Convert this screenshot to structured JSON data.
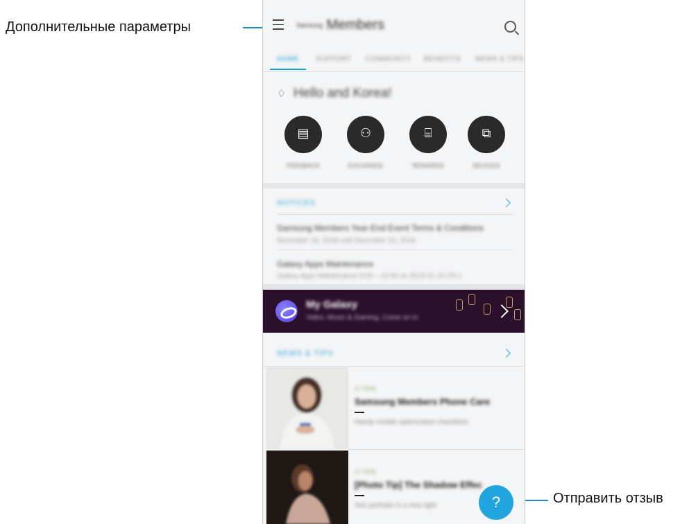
{
  "callouts": {
    "left": "Дополнительные параметры",
    "right": "Отправить отзыв"
  },
  "app": {
    "title_prefix": "Samsung",
    "title": "Members",
    "menu_icon": "hamburger-menu-icon",
    "search_icon": "search-icon"
  },
  "tabs": [
    "HOME",
    "SUPPORT",
    "COMMUNITY",
    "BENEFITS",
    "NEWS & TIPS"
  ],
  "greeting": "Hello and Korea!",
  "quick_actions": [
    {
      "icon": "document-icon",
      "glyph": "▤",
      "label": "FEEDBACK"
    },
    {
      "icon": "people-icon",
      "glyph": "⚇",
      "label": "EXCHANGE"
    },
    {
      "icon": "gift-icon",
      "glyph": "⌸",
      "label": "REWARDS"
    },
    {
      "icon": "devices-icon",
      "glyph": "⧉",
      "label": "DEVICES"
    }
  ],
  "notices": {
    "title": "NOTICES",
    "items": [
      {
        "title": "Samsung Members Year-End Event Terms & Conditions",
        "sub": "December 18, 2018 until December 31, 2018"
      },
      {
        "title": "Galaxy Apps Maintenance",
        "sub": "Galaxy Apps Maintenance 9:00 – 12:00 on 2019.01.10 (Th.)"
      }
    ]
  },
  "banner": {
    "title": "My Galaxy",
    "sub": "Video, Music & Gaming, Come on in."
  },
  "news": {
    "title": "NEWS & TIPS",
    "items": [
      {
        "tag": "IT TIPS",
        "title": "Samsung Members Phone Care",
        "sub": "Handy mobile optimization checklists"
      },
      {
        "tag": "IT TIPS",
        "title": "[Photo Tip] The Shadow Effec",
        "sub": "See portraits in a new light"
      }
    ]
  },
  "help_button": "?",
  "colors": {
    "accent": "#1a9fd6",
    "callout_line": "#1e88c8",
    "banner_bg": "#2b0f2b",
    "fab": "#21a5de"
  }
}
